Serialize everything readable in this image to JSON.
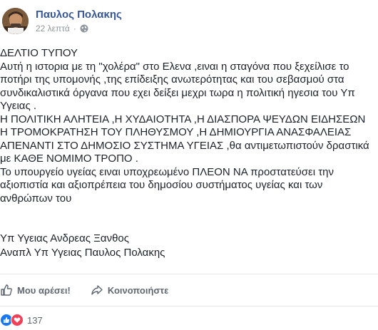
{
  "post": {
    "author": "Παυλος Πολακης",
    "time": "22 λεπτά",
    "separator": "·",
    "body_lines": [
      "ΔΕΛΤΙΟ ΤΥΠΟΥ",
      "Αυτή η ιστορια με τη \"χολέρα\" στο Ελενα ,ειναι η σταγόνα που ξεχείλισε το",
      "ποτήρι της υπομονής ,της επίδειξης ανωτερότητας και του σεβασμού στα",
      "συνδικαλιστικά όργανα που εχει δείξει μεχρι τωρα η πολιτική ηγεσια του Υπ",
      "Υγειας .",
      "Η ΠΟΛΙΤΙΚΗ ΑΛΗΤΕΙΑ ,Η ΧΥΔΑΙΟΤΗΤΑ ,Η ΔΙΑΣΠΟΡΑ ΨΕΥΔΩΝ ΕΙΔΗΣΕΩΝ",
      "Η ΤΡΟΜΟΚΡΑΤΗΣΗ ΤΟΥ ΠΛΗΘΥΣΜΟΥ ,Η ΔΗΜΙΟΥΡΓΙΑ ΑΝΑΣΦΑΛΕΙΑΣ",
      "ΑΠΕΝΑΝΤΙ ΣΤΟ ΔΗΜΟΣΙΟ ΣΥΣΤΗΜΑ ΥΓΕΙΑΣ ,θα αντιμετωπιστούν δραστικά",
      "με ΚΑΘΕ ΝΟΜΙΜΟ ΤΡΟΠΟ .",
      "Το υπουργείο υγείας ειναι υποχρεωμένο ΠΛΕΟΝ ΝΑ προστατεύσει την",
      "αξιοπιστία και αξιοπρέπεια του δημοσίου συστήματος υγείας και των",
      "ανθρώπων του"
    ],
    "signature": [
      "Υπ Υγειας Ανδρεας Ξανθος",
      "Αναπλ Υπ Υγειας Παυλος Πολακης"
    ]
  },
  "actions": {
    "like_label": "Μου αρέσει!",
    "share_label": "Κοινοποιήστε"
  },
  "reactions": {
    "count": "137"
  },
  "colors": {
    "author": "#365899",
    "meta": "#90949c",
    "like": "#1877f2",
    "love": "#f33e58"
  }
}
